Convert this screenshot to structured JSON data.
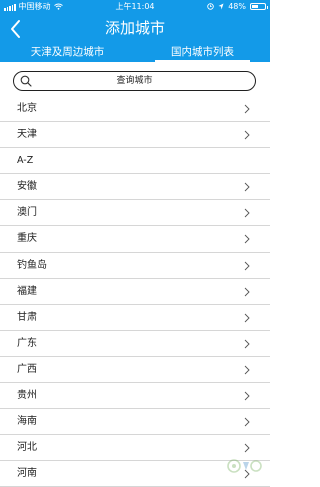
{
  "status_bar": {
    "carrier": "中国移动",
    "time": "上午11:04",
    "battery": "48%",
    "battery_level": 0.48
  },
  "nav": {
    "title": "添加城市",
    "back_icon": "chevron-left-icon"
  },
  "tabs": [
    {
      "label": "天津及周边城市",
      "active": false
    },
    {
      "label": "国内城市列表",
      "active": true
    }
  ],
  "search": {
    "label": "查询城市",
    "icon": "search-icon"
  },
  "list": {
    "top_items": [
      {
        "label": "北京"
      },
      {
        "label": "天津"
      }
    ],
    "section_header": "A-Z",
    "provinces": [
      {
        "label": "安徽"
      },
      {
        "label": "澳门"
      },
      {
        "label": "重庆"
      },
      {
        "label": "钓鱼岛"
      },
      {
        "label": "福建"
      },
      {
        "label": "甘肃"
      },
      {
        "label": "广东"
      },
      {
        "label": "广西"
      },
      {
        "label": "贵州"
      },
      {
        "label": "海南"
      },
      {
        "label": "河北"
      },
      {
        "label": "河南"
      }
    ]
  },
  "colors": {
    "brand_blue": "#139ae8",
    "divider": "#d6d6d6",
    "text": "#222222"
  }
}
